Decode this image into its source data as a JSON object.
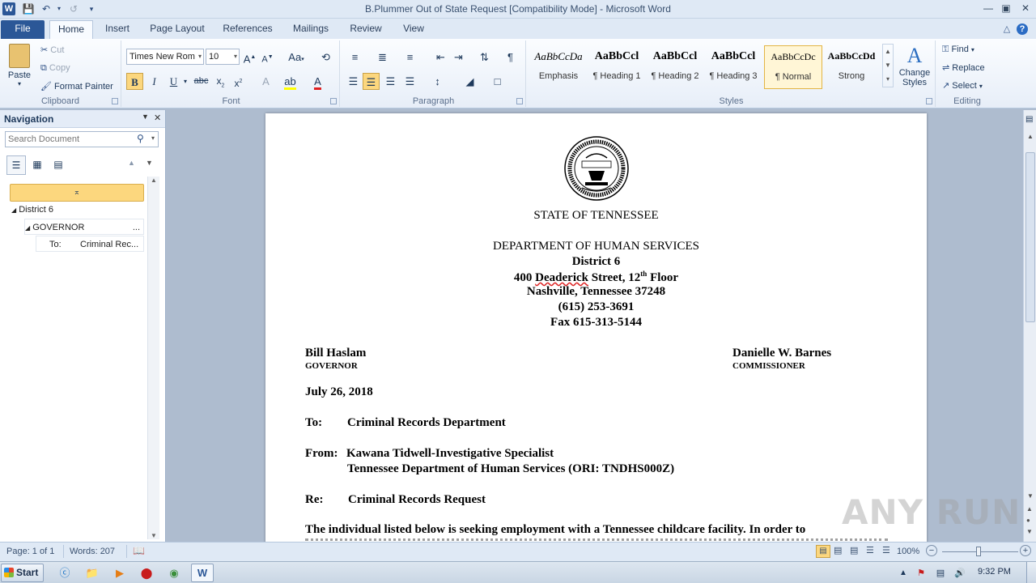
{
  "window": {
    "title": "B.Plummer Out of State Request [Compatibility Mode]  -  Microsoft Word"
  },
  "ribbon_tabs": [
    "File",
    "Home",
    "Insert",
    "Page Layout",
    "References",
    "Mailings",
    "Review",
    "View"
  ],
  "clipboard": {
    "paste": "Paste",
    "cut": "Cut",
    "copy": "Copy",
    "format_painter": "Format Painter",
    "label": "Clipboard"
  },
  "font": {
    "name": "Times New Rom",
    "size": "10",
    "label": "Font"
  },
  "paragraph": {
    "label": "Paragraph"
  },
  "styles": {
    "label": "Styles",
    "items": [
      {
        "preview": "AaBbCcDa",
        "name": "Emphasis"
      },
      {
        "preview": "AaBbCcl",
        "name": "¶ Heading 1"
      },
      {
        "preview": "AaBbCcl",
        "name": "¶ Heading 2"
      },
      {
        "preview": "AaBbCcl",
        "name": "¶ Heading 3"
      },
      {
        "preview": "AaBbCcDc",
        "name": "¶ Normal"
      },
      {
        "preview": "AaBbCcDd",
        "name": "Strong"
      }
    ],
    "change_styles": "Change Styles"
  },
  "editing": {
    "label": "Editing",
    "find": "Find",
    "replace": "Replace",
    "select": "Select"
  },
  "navigation": {
    "title": "Navigation",
    "search_placeholder": "Search Document",
    "items": [
      "District 6",
      "GOVERNOR",
      "To:",
      "Criminal Rec...",
      "..."
    ]
  },
  "document": {
    "state": "STATE  OF TENNESSEE",
    "department": "DEPARTMENT  OF HUMAN SERVICES",
    "district": "District 6",
    "address_num": "400",
    "address_street": "Deaderick",
    "address_rest": "Street, 12",
    "address_sup": "th",
    "address_floor": "Floor",
    "city": "Nashville, Tennessee 37248",
    "phone": "(615) 253-3691",
    "fax": "Fax 615-313-5144",
    "left_name": "Bill Haslam",
    "left_title": "GOVERNOR",
    "right_name": "Danielle W. Barnes",
    "right_title": "COMMISSIONER",
    "date": "July 26, 2018",
    "to_label": "To:",
    "to_value": "Criminal  Records Department",
    "from_label": "From:",
    "from_value": "Kawana  Tidwell-Investigative  Specialist",
    "from_value2": "Tennessee Department of Human  Services (ORI: TNDHS000Z)",
    "re_label": "Re:",
    "re_value": "Criminal  Records Request",
    "body": "The  individual  listed  below  is  seeking  employment  with  a  Tennessee  childcare  facility.   In  order  to"
  },
  "status": {
    "page": "Page: 1 of 1",
    "words": "Words: 207",
    "zoom": "100%"
  },
  "taskbar": {
    "start": "Start",
    "time": "9:32 PM"
  },
  "watermark": "ANY RUN",
  "colors": {
    "file_tab": "#2b5797",
    "ribbon_bg": "#e7eef8",
    "highlight": "#fcd77e"
  }
}
